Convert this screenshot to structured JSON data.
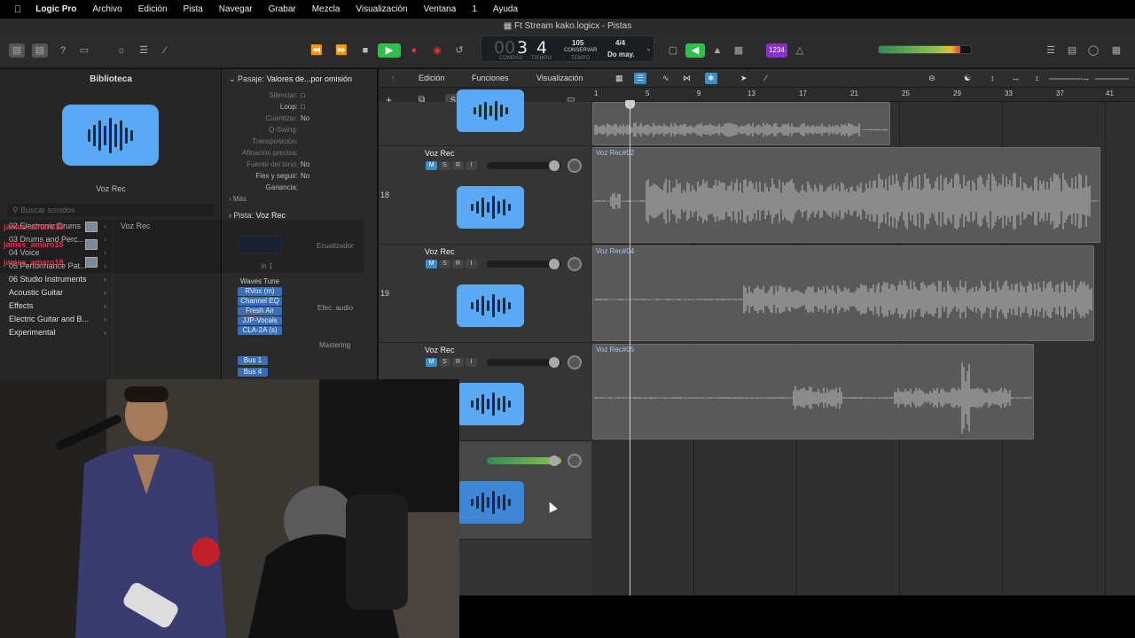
{
  "menubar": {
    "apple": "",
    "app": "Logic Pro",
    "items": [
      "Archivo",
      "Edición",
      "Pista",
      "Navegar",
      "Grabar",
      "Mezcla",
      "Visualización",
      "Ventana",
      "1",
      "Ayuda"
    ]
  },
  "window": {
    "title": "Ft Stream kako.logicx - Pistas"
  },
  "lcd": {
    "bar": "3",
    "beat": "4",
    "bar_label": "COMPÁS",
    "beat_label": "TIEMPO",
    "tempo": "105",
    "tempo_mode": "CONSERVAR",
    "tempo_label": "TEMPO",
    "signature": "4/4",
    "key": "Do may."
  },
  "count_in": "1234",
  "library": {
    "title": "Biblioteca",
    "patch_name": "Voz Rec",
    "search_placeholder": "Buscar sonidos",
    "categories": [
      {
        "label": "02 Electronic Drums"
      },
      {
        "label": "03 Drums and Perc..."
      },
      {
        "label": "04 Voice"
      },
      {
        "label": "05 Performance Pat..."
      },
      {
        "label": "06 Studio Instruments"
      },
      {
        "label": "Acoustic Guitar"
      },
      {
        "label": "Effects"
      },
      {
        "label": "Electric Guitar and B..."
      },
      {
        "label": "Experimental"
      }
    ],
    "patches": [
      "Voz Rec"
    ]
  },
  "chat": {
    "names": [
      "james_amaro18",
      "james_amaro18",
      "james_amaro18"
    ]
  },
  "inspector": {
    "region_header_label": "Pasaje:",
    "region_header_value": "Valores de...por omisión",
    "rows": [
      {
        "key": "Silenciar:",
        "value": ""
      },
      {
        "key": "Loop:",
        "value": ""
      },
      {
        "key": "Cuantizar:",
        "value": "No"
      },
      {
        "key": "Q-Swing:",
        "value": ""
      },
      {
        "key": "Transposición:",
        "value": ""
      },
      {
        "key": "Afinación precisa:",
        "value": ""
      },
      {
        "key": "Fuente del tono:",
        "value": "No"
      },
      {
        "key": "Flex y seguir:",
        "value": "No"
      },
      {
        "key": "Ganancia:",
        "value": ""
      }
    ],
    "more": "Más",
    "track_header_label": "Pista:",
    "track_header_value": "Voz Rec",
    "eq_label": "Ecualizador",
    "input": "In 1",
    "plugins": [
      "Waves Tune",
      "RVox (m)",
      "Channel EQ",
      "Fresh Air",
      "JJP-Vocals",
      "CLA-2A (s)"
    ],
    "sends": [
      "Bus 1",
      "Bus 4"
    ],
    "audio_fx_label": "Efec. audio",
    "mastering_label": "Mastering"
  },
  "arrange": {
    "menus": [
      "Edición",
      "Funciones",
      "Visualización"
    ],
    "ruler": [
      "1",
      "5",
      "9",
      "13",
      "17",
      "21",
      "25",
      "29",
      "33",
      "37",
      "41"
    ],
    "add_label": "+",
    "solo_label": "S"
  },
  "tracks": [
    {
      "number": "",
      "name": "",
      "region": ""
    },
    {
      "number": "18",
      "name": "Voz Rec",
      "region": "Voz Rec#02"
    },
    {
      "number": "19",
      "name": "Voz Rec",
      "region": "Voz Rec#04"
    },
    {
      "number": "",
      "name": "Voz Rec",
      "region": "Voz Rec#05"
    },
    {
      "number": "",
      "name": "",
      "region": ""
    }
  ],
  "msri": {
    "m": "M",
    "s": "S",
    "r": "R",
    "i": "I"
  },
  "colors": {
    "accent": "#5aa9f5",
    "region": "#595959",
    "play": "#2fbf4a",
    "record": "#e0303a"
  }
}
